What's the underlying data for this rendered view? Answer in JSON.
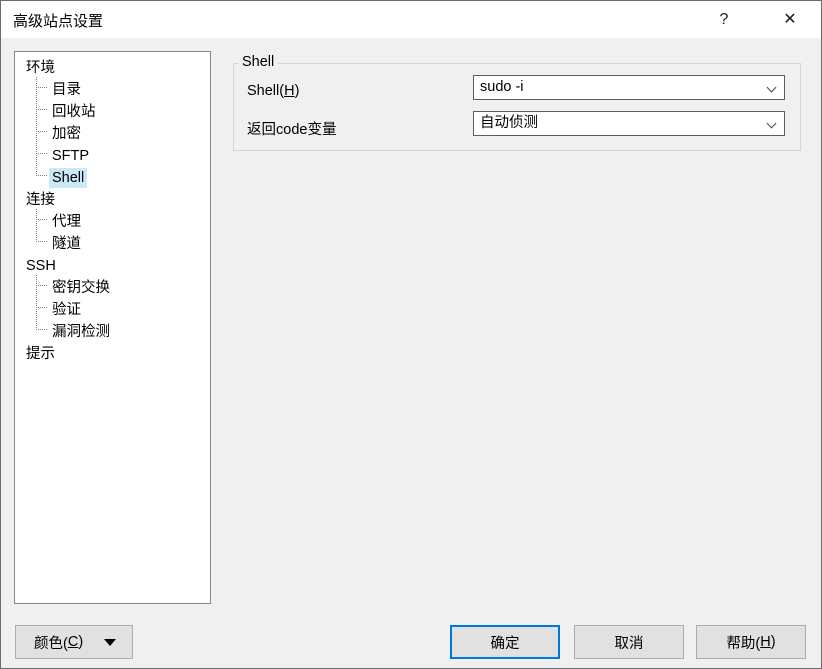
{
  "window": {
    "title": "高级站点设置",
    "caption_buttons": [
      {
        "name": "help-caption-button",
        "glyph": "?"
      },
      {
        "name": "close-caption-button",
        "glyph": "✕"
      }
    ]
  },
  "tree": {
    "items": [
      {
        "label": "环境",
        "level": 0,
        "selected": false,
        "last_child": false
      },
      {
        "label": "目录",
        "level": 1,
        "selected": false,
        "last_child": false
      },
      {
        "label": "回收站",
        "level": 1,
        "selected": false,
        "last_child": false
      },
      {
        "label": "加密",
        "level": 1,
        "selected": false,
        "last_child": false
      },
      {
        "label": "SFTP",
        "level": 1,
        "selected": false,
        "last_child": false
      },
      {
        "label": "Shell",
        "level": 1,
        "selected": true,
        "last_child": true
      },
      {
        "label": "连接",
        "level": 0,
        "selected": false,
        "last_child": false
      },
      {
        "label": "代理",
        "level": 1,
        "selected": false,
        "last_child": false
      },
      {
        "label": "隧道",
        "level": 1,
        "selected": false,
        "last_child": true
      },
      {
        "label": "SSH",
        "level": 0,
        "selected": false,
        "last_child": false
      },
      {
        "label": "密钥交换",
        "level": 1,
        "selected": false,
        "last_child": false
      },
      {
        "label": "验证",
        "level": 1,
        "selected": false,
        "last_child": false
      },
      {
        "label": "漏洞检测",
        "level": 1,
        "selected": false,
        "last_child": true
      },
      {
        "label": "提示",
        "level": 0,
        "selected": false,
        "last_child": false
      }
    ]
  },
  "shell_group": {
    "title": "Shell",
    "shell_label_prefix": "Shell(",
    "shell_label_accel": "H",
    "shell_label_suffix": ")",
    "shell_value": "sudo -i",
    "retcode_label": "返回code变量",
    "retcode_value": "自动侦测"
  },
  "footer": {
    "color_label": "颜色(C)",
    "color_label_prefix": "颜色(",
    "color_label_accel": "C",
    "color_label_suffix": ")",
    "ok_label": "确定",
    "cancel_label": "取消",
    "help_label_prefix": "帮助(",
    "help_label_accel": "H",
    "help_label_suffix": ")"
  },
  "colors": {
    "accent": "#0078d7",
    "selection": "#cbe8f6",
    "window_bg": "#f0f0f0",
    "field_bg": "#ffffff",
    "button_face": "#e1e1e1"
  }
}
